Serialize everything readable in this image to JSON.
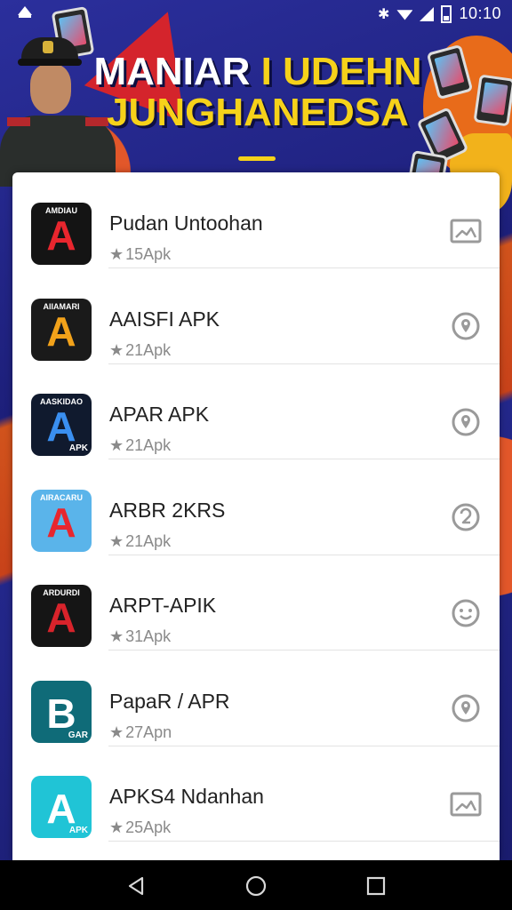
{
  "status_bar": {
    "time": "10:10"
  },
  "banner": {
    "title_line1_a": "MANIAR",
    "title_line1_b": "I UDEHN",
    "title_line2": "JUNGHANEDSA"
  },
  "apps": [
    {
      "icon_brand": "AMDIAU",
      "icon_letter": "A",
      "icon_bg": "#141414",
      "icon_letter_color": "#e8262e",
      "name": "Pudan Untoohan",
      "size": "15Apk",
      "action_icon": "image-icon"
    },
    {
      "icon_brand": "AIIAMARI",
      "icon_letter": "A",
      "icon_bg": "#1a1a1a",
      "icon_letter_color": "#f2a21a",
      "name": "AAISFI APK",
      "size": "21Apk",
      "action_icon": "location-pin-icon"
    },
    {
      "icon_brand": "AASKIDAO",
      "icon_letter": "A",
      "icon_bg": "#101a2e",
      "icon_letter_color": "#3a8ff0",
      "icon_sub": "APK",
      "name": "APAR APK",
      "size": "21Apk",
      "action_icon": "location-pin-icon"
    },
    {
      "icon_brand": "AIRACARU",
      "icon_letter": "A",
      "icon_bg": "#5ab4ea",
      "icon_letter_color": "#e8262e",
      "name": "ARBR 2KRS",
      "size": "21Apk",
      "action_icon": "download-circle-icon"
    },
    {
      "icon_brand": "ARDURDI",
      "icon_letter": "A",
      "icon_bg": "#151515",
      "icon_letter_color": "#d8232b",
      "name": "ARPT-APIK",
      "size": "31Apk",
      "action_icon": "smile-circle-icon"
    },
    {
      "icon_brand": "",
      "icon_letter": "B",
      "icon_bg": "#0f6b78",
      "icon_letter_color": "#ffffff",
      "icon_sub": "GAR",
      "name": "PapaR / APR",
      "size": "27Apn",
      "action_icon": "location-pin-icon"
    },
    {
      "icon_brand": "",
      "icon_letter": "A",
      "icon_bg": "#20c4d6",
      "icon_letter_color": "#ffffff",
      "icon_sub": "APK",
      "name": "APKS4 Ndanhan",
      "size": "25Apk",
      "action_icon": "image-icon"
    }
  ],
  "colors": {
    "banner_yellow": "#f6d21a",
    "card_bg": "#ffffff",
    "text_primary": "#222222",
    "text_secondary": "#8a8a8a",
    "action_gray": "#9a9a9a"
  }
}
